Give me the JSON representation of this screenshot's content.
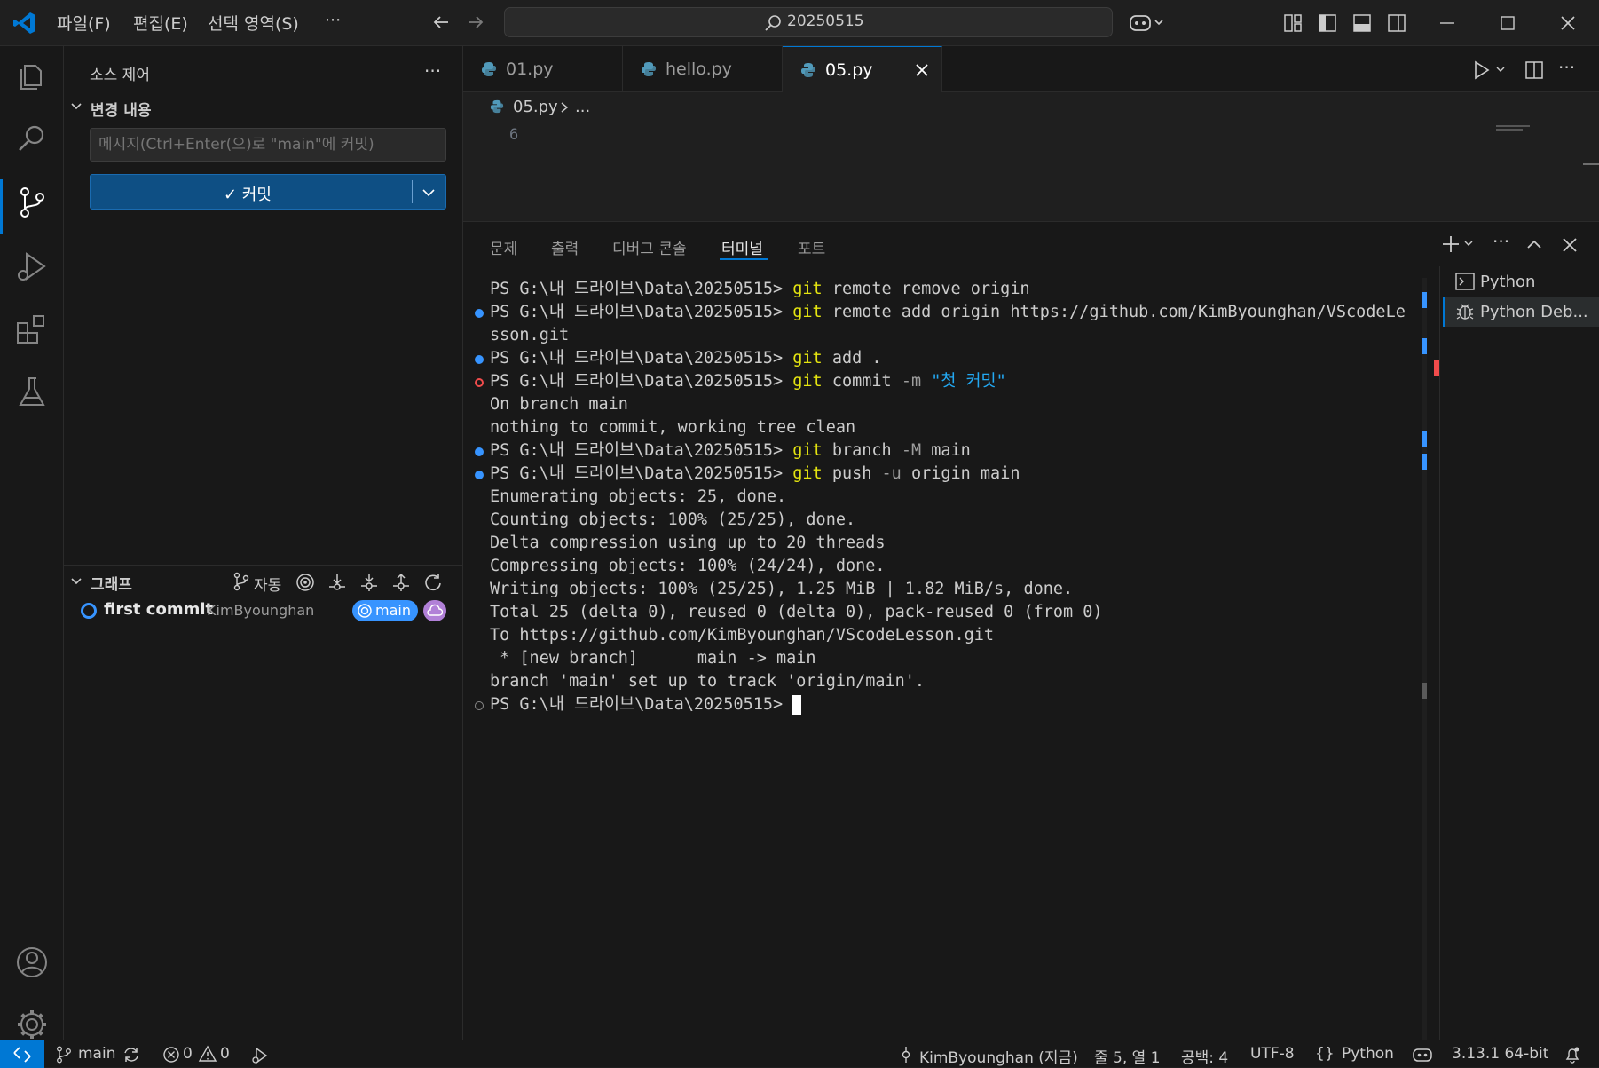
{
  "titlebar": {
    "menus": [
      "파일(F)",
      "편집(E)",
      "선택 영역(S)",
      "···"
    ],
    "search_text": "20250515"
  },
  "sidebar": {
    "title": "소스 제어",
    "changes_header": "변경 내용",
    "commit_placeholder": "메시지(Ctrl+Enter(으)로 \"main\"에 커밋)",
    "commit_button": "✓ 커밋",
    "graph_header": "그래프",
    "graph_auto": "자동",
    "commit": {
      "message": "first commit",
      "author": "KimByounghan",
      "branch": "main"
    }
  },
  "editor": {
    "tabs": [
      {
        "label": "01.py",
        "active": false
      },
      {
        "label": "hello.py",
        "active": false
      },
      {
        "label": "05.py",
        "active": true
      }
    ],
    "breadcrumb_file": "05.py",
    "breadcrumb_rest": "...",
    "line_number": "6"
  },
  "panel": {
    "tabs": [
      "문제",
      "출력",
      "디버그 콘솔",
      "터미널",
      "포트"
    ],
    "active_tab": "터미널",
    "terminals": [
      "Python",
      "Python Deb..."
    ]
  },
  "terminal": {
    "prompt": "PS G:\\내 드라이브\\Data\\20250515> ",
    "lines": [
      {
        "dot": "",
        "segments": [
          {
            "t": "p",
            "v": "PS G:\\내 드라이브\\Data\\20250515> "
          },
          {
            "t": "cmd",
            "v": "git"
          },
          {
            "t": "n",
            "v": " remote remove origin"
          }
        ]
      },
      {
        "dot": "blue",
        "segments": [
          {
            "t": "p",
            "v": "PS G:\\내 드라이브\\Data\\20250515> "
          },
          {
            "t": "cmd",
            "v": "git"
          },
          {
            "t": "n",
            "v": " remote add origin https://github.com/KimByounghan/VScodeLe"
          }
        ]
      },
      {
        "dot": "",
        "segments": [
          {
            "t": "n",
            "v": "sson.git"
          }
        ]
      },
      {
        "dot": "blue",
        "segments": [
          {
            "t": "p",
            "v": "PS G:\\내 드라이브\\Data\\20250515> "
          },
          {
            "t": "cmd",
            "v": "git"
          },
          {
            "t": "n",
            "v": " add ."
          }
        ]
      },
      {
        "dot": "red",
        "segments": [
          {
            "t": "p",
            "v": "PS G:\\내 드라이브\\Data\\20250515> "
          },
          {
            "t": "cmd",
            "v": "git"
          },
          {
            "t": "n",
            "v": " commit "
          },
          {
            "t": "flag",
            "v": "-m"
          },
          {
            "t": "n",
            "v": " "
          },
          {
            "t": "str",
            "v": "\"첫 커밋\""
          }
        ]
      },
      {
        "dot": "",
        "segments": [
          {
            "t": "n",
            "v": "On branch main"
          }
        ]
      },
      {
        "dot": "",
        "segments": [
          {
            "t": "n",
            "v": "nothing to commit, working tree clean"
          }
        ]
      },
      {
        "dot": "blue",
        "segments": [
          {
            "t": "p",
            "v": "PS G:\\내 드라이브\\Data\\20250515> "
          },
          {
            "t": "cmd",
            "v": "git"
          },
          {
            "t": "n",
            "v": " branch "
          },
          {
            "t": "flag",
            "v": "-M"
          },
          {
            "t": "n",
            "v": " main"
          }
        ]
      },
      {
        "dot": "blue",
        "segments": [
          {
            "t": "p",
            "v": "PS G:\\내 드라이브\\Data\\20250515> "
          },
          {
            "t": "cmd",
            "v": "git"
          },
          {
            "t": "n",
            "v": " push "
          },
          {
            "t": "flag",
            "v": "-u"
          },
          {
            "t": "n",
            "v": " origin main"
          }
        ]
      },
      {
        "dot": "",
        "segments": [
          {
            "t": "n",
            "v": "Enumerating objects: 25, done."
          }
        ]
      },
      {
        "dot": "",
        "segments": [
          {
            "t": "n",
            "v": "Counting objects: 100% (25/25), done."
          }
        ]
      },
      {
        "dot": "",
        "segments": [
          {
            "t": "n",
            "v": "Delta compression using up to 20 threads"
          }
        ]
      },
      {
        "dot": "",
        "segments": [
          {
            "t": "n",
            "v": "Compressing objects: 100% (24/24), done."
          }
        ]
      },
      {
        "dot": "",
        "segments": [
          {
            "t": "n",
            "v": "Writing objects: 100% (25/25), 1.25 MiB | 1.82 MiB/s, done."
          }
        ]
      },
      {
        "dot": "",
        "segments": [
          {
            "t": "n",
            "v": "Total 25 (delta 0), reused 0 (delta 0), pack-reused 0 (from 0)"
          }
        ]
      },
      {
        "dot": "",
        "segments": [
          {
            "t": "n",
            "v": "To https://github.com/KimByounghan/VScodeLesson.git"
          }
        ]
      },
      {
        "dot": "",
        "segments": [
          {
            "t": "n",
            "v": " * [new branch]      main -> main"
          }
        ]
      },
      {
        "dot": "",
        "segments": [
          {
            "t": "n",
            "v": "branch 'main' set up to track 'origin/main'."
          }
        ]
      },
      {
        "dot": "hollow",
        "segments": [
          {
            "t": "p",
            "v": "PS G:\\내 드라이브\\Data\\20250515> "
          }
        ],
        "cursor": true
      }
    ]
  },
  "statusbar": {
    "branch": "main",
    "errors": "0",
    "warnings": "0",
    "blame": "KimByounghan (지금)",
    "position": "줄 5, 열 1",
    "spaces": "공백: 4",
    "encoding": "UTF-8",
    "language": "Python",
    "interpreter": "3.13.1 64-bit"
  },
  "colors": {
    "accent": "#0078d4",
    "cmd": "#e5e510",
    "string": "#23a8f2",
    "error": "#f14c4c",
    "badge_main": "#3794ff",
    "badge_cloud": "#b180d7"
  }
}
